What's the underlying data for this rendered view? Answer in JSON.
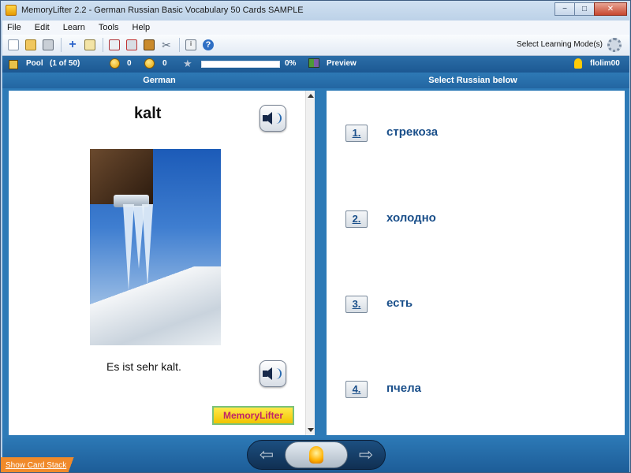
{
  "window": {
    "title": "MemoryLifter 2.2 - German Russian Basic Vocabulary 50 Cards SAMPLE",
    "minimize_glyph": "−",
    "maximize_glyph": "□",
    "close_glyph": "✕"
  },
  "menu": [
    "File",
    "Edit",
    "Learn",
    "Tools",
    "Help"
  ],
  "toolbar": {
    "icons": [
      "new-icon",
      "open-icon",
      "print-icon",
      "add-card-icon",
      "edit-icon",
      "presentation-icon",
      "export-icon",
      "book-icon",
      "settings-tools-icon",
      "info-icon",
      "help-icon"
    ],
    "learning_mode_label": "Select Learning Mode(s)"
  },
  "status": {
    "pool_label": "Pool",
    "pool_count": "(1 of 50)",
    "happy_count": "0",
    "sad_count": "0",
    "progress_percent": 0,
    "progress_label": "0%",
    "preview_label": "Preview",
    "user": "flolim00"
  },
  "question": {
    "column_header": "German",
    "word": "kalt",
    "sentence": "Es ist sehr kalt.",
    "logo_text": "MemoryLifter"
  },
  "answers": {
    "column_header": "Select Russian below",
    "items": [
      {
        "num": "1.",
        "text": "стрекоза"
      },
      {
        "num": "2.",
        "text": "холодно"
      },
      {
        "num": "3.",
        "text": "есть"
      },
      {
        "num": "4.",
        "text": "пчела"
      }
    ]
  },
  "bottom": {
    "show_card_stack": "Show Card Stack",
    "prev_glyph": "⇦",
    "next_glyph": "⇨"
  },
  "colors": {
    "accent": "#2d7ab7",
    "answer_text": "#1a4f8a"
  }
}
